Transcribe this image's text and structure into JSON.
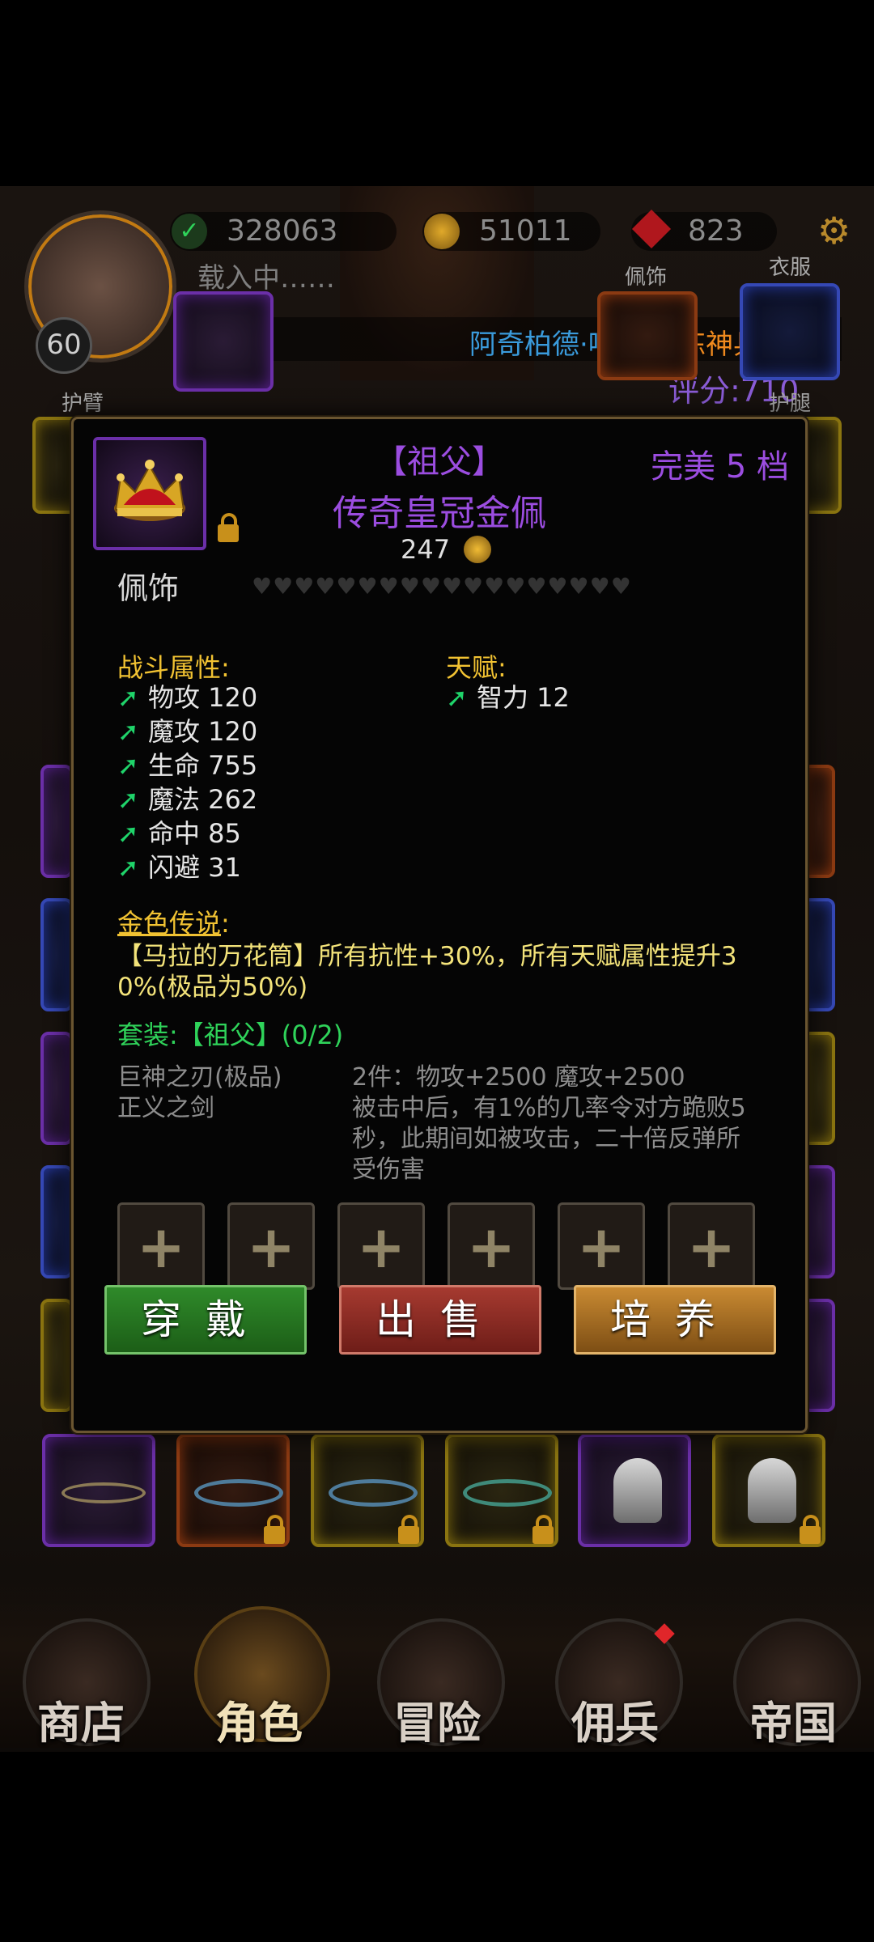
{
  "hud": {
    "power": "328063",
    "gold": "51011",
    "gems": "823",
    "loading": "载入中……",
    "level": "60",
    "marquee_name": "阿奇柏德·呼延",
    "marquee_action": "精炼神兵[",
    "score": "评分:710",
    "slot_labels": {
      "bracer": "护臂",
      "accessory": "佩饰",
      "clothes": "衣服",
      "leggings": "护腿"
    }
  },
  "item": {
    "set_title": "【祖父】",
    "name": "传奇皇冠金佩",
    "quality": "完美 5 档",
    "price": "247",
    "slot_type": "佩饰",
    "heart_count": 18,
    "combat_header": "战斗属性:",
    "combat_stats": [
      "物攻 120",
      "魔攻 120",
      "生命 755",
      "魔法 262",
      "命中 85",
      "闪避 31"
    ],
    "talent_header": "天赋:",
    "talent_stats": [
      "智力 12"
    ],
    "legend_header": "金色传说",
    "legend_colon": ":",
    "legend_text_line1": "【马拉的万花筒】所有抗性+30%，所有天赋属性提升3",
    "legend_text_line2": "0%(极品为50%)",
    "set_header": "套装:【祖父】(0/2)",
    "set_pieces": [
      "巨神之刃(极品)",
      "正义之剑"
    ],
    "set_bonus_line1": "2件：物攻+2500 魔攻+2500",
    "set_bonus_line2": "被击中后，有1%的几率令对方跪败5",
    "set_bonus_line3": "秒，此期间如被攻击，二十倍反弹所",
    "set_bonus_line4": "受伤害",
    "socket_symbol": "+",
    "buttons": {
      "equip": "穿戴",
      "sell": "出售",
      "train": "培养"
    }
  },
  "nav": {
    "shop": "商店",
    "character": "角色",
    "adventure": "冒险",
    "mercenary": "佣兵",
    "empire": "帝国"
  },
  "colors": {
    "title_purple": "#9b4de0",
    "gold_text": "#f1c232",
    "legend_text": "#f3e37a",
    "set_green": "#2fd35a",
    "marquee_blue": "#3a9bdc",
    "marquee_orange": "#f08a1e"
  }
}
